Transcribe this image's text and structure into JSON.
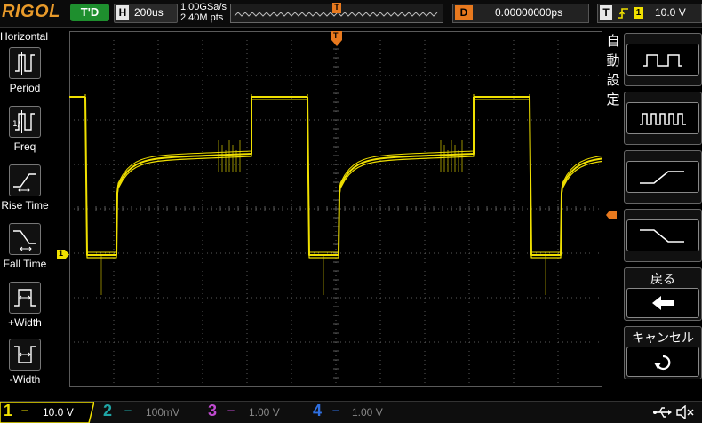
{
  "brand": "RIGOL",
  "top": {
    "run_state": "T'D",
    "horizontal_label": "H",
    "timebase": "200us",
    "sample_rate": "1.00GSa/s",
    "memory_points": "2.40M pts",
    "memory_trigger_marker": "T",
    "delay_label": "D",
    "delay_value": "0.00000000ps",
    "trigger_label": "T",
    "trigger_slope_icon": "rising-edge-icon",
    "trigger_source": "1",
    "trigger_level": "10.0 V"
  },
  "left_menu": {
    "title": "Horizontal",
    "items": [
      {
        "label": "Period",
        "icon": "period-icon"
      },
      {
        "label": "Freq",
        "icon": "frequency-icon"
      },
      {
        "label": "Rise Time",
        "icon": "rise-time-icon"
      },
      {
        "label": "Fall Time",
        "icon": "fall-time-icon"
      },
      {
        "label": "+Width",
        "icon": "positive-width-icon"
      },
      {
        "label": "-Width",
        "icon": "negative-width-icon"
      }
    ]
  },
  "right_menu": {
    "auto_label_vertical": [
      "自",
      "動",
      "設",
      "定"
    ],
    "buttons": [
      {
        "label": "",
        "icon": "single-period-icon"
      },
      {
        "label": "",
        "icon": "multi-period-icon"
      },
      {
        "label": "",
        "icon": "rise-time-icon"
      },
      {
        "label": "",
        "icon": "fall-time-icon"
      },
      {
        "label": "戻る",
        "icon": "back-arrow-icon"
      },
      {
        "label": "キャンセル",
        "icon": "undo-icon"
      }
    ]
  },
  "markers": {
    "channel1_level": "1",
    "trigger_top": "T"
  },
  "bottom": {
    "channels": [
      {
        "number": "1",
        "coupling": "DC",
        "scale": "10.0 V",
        "color": "#f0e000"
      },
      {
        "number": "2",
        "coupling": "DC",
        "scale": "100mV",
        "color": "#1fa5a5"
      },
      {
        "number": "3",
        "coupling": "DC",
        "scale": "1.00 V",
        "color": "#c04ad0"
      },
      {
        "number": "4",
        "coupling": "DC",
        "scale": "1.00 V",
        "color": "#2f6fe0"
      }
    ],
    "usb_icon": "usb-icon",
    "sound_icon": "speaker-muted-icon"
  },
  "colors": {
    "trace": "#f0e000",
    "grid": "#5a5a5a",
    "trigger_marker": "#e8791e",
    "brand": "#e89a2a"
  }
}
